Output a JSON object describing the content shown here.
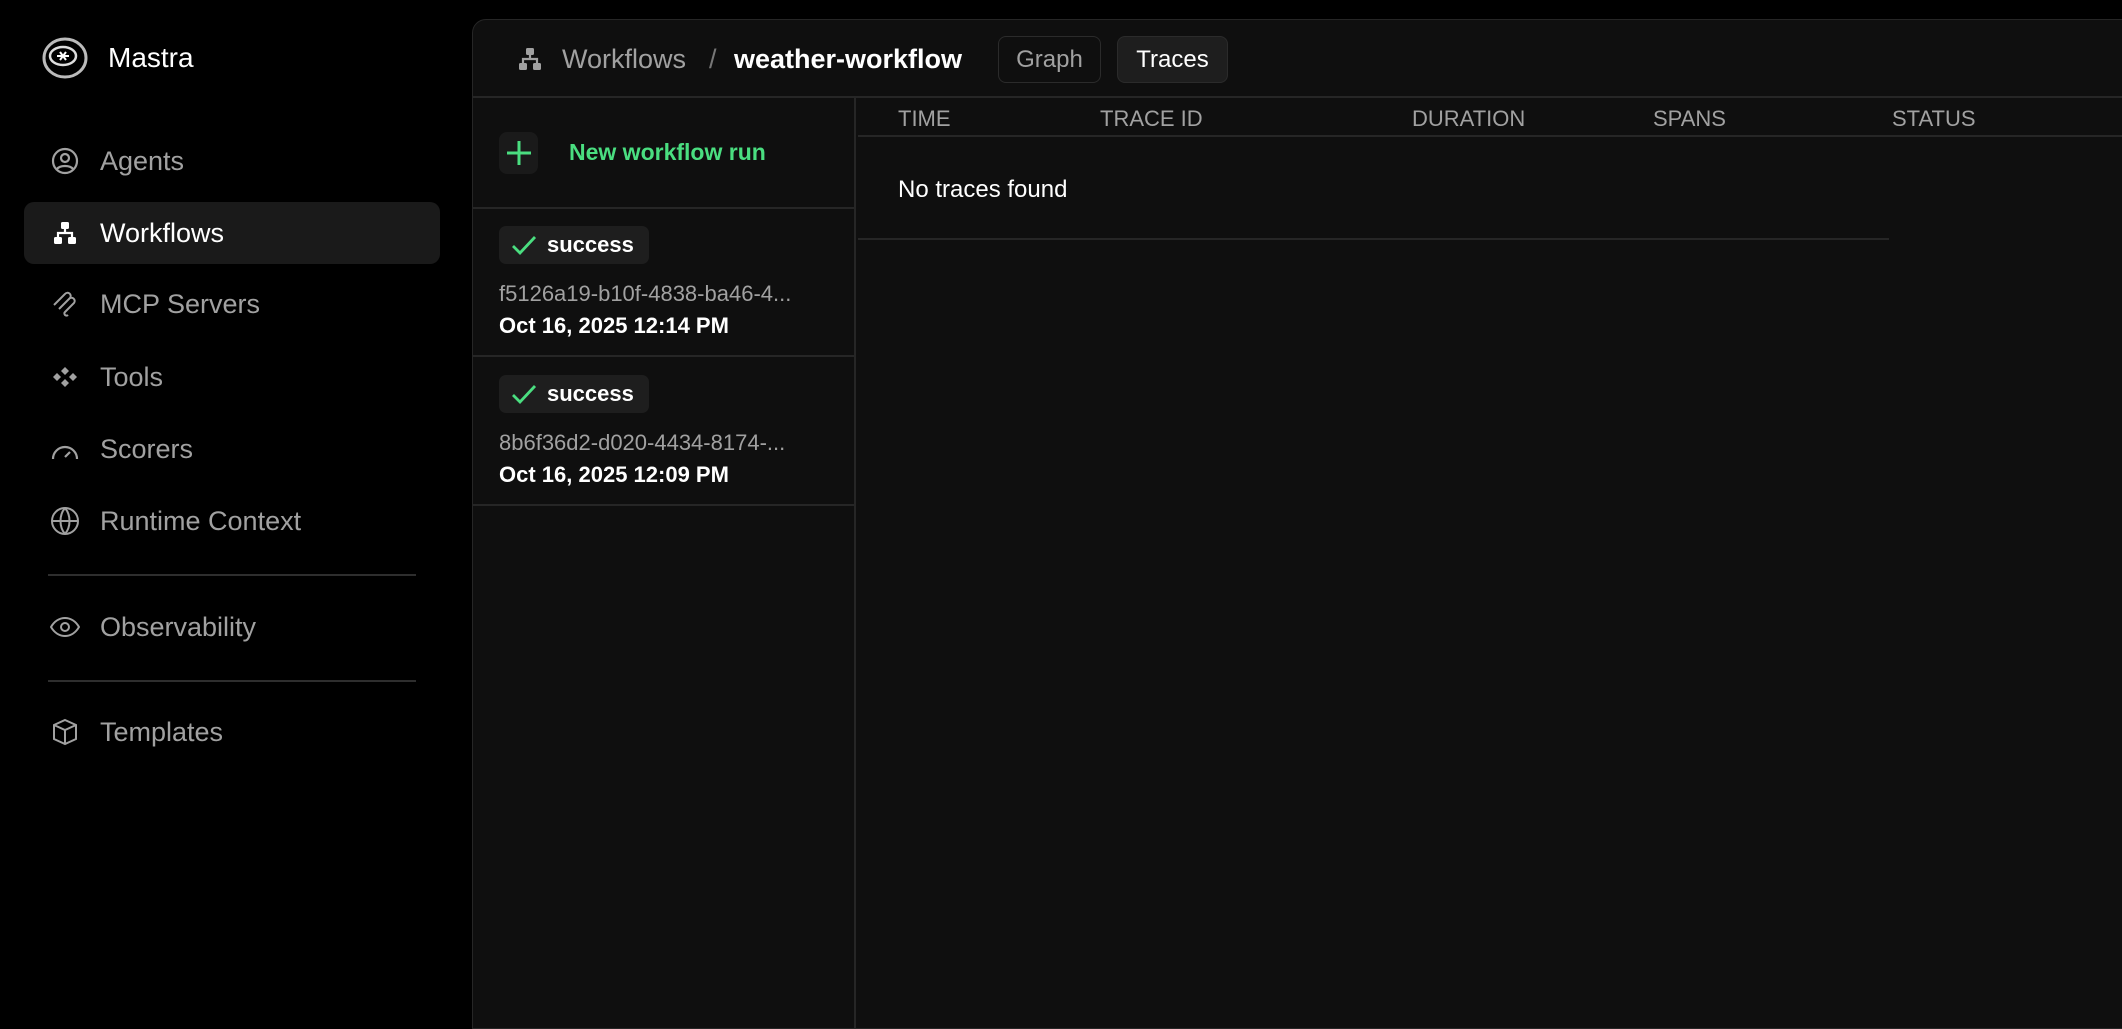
{
  "app": {
    "brand": "Mastra"
  },
  "sidebar": {
    "items": [
      {
        "label": "Agents",
        "icon": "user-circle-icon"
      },
      {
        "label": "Workflows",
        "icon": "workflow-icon",
        "active": true
      },
      {
        "label": "MCP Servers",
        "icon": "mcp-icon"
      },
      {
        "label": "Tools",
        "icon": "tools-icon"
      },
      {
        "label": "Scorers",
        "icon": "gauge-icon"
      },
      {
        "label": "Runtime Context",
        "icon": "globe-icon"
      },
      {
        "label": "Observability",
        "icon": "eye-icon"
      },
      {
        "label": "Templates",
        "icon": "box-icon"
      }
    ]
  },
  "header": {
    "crumb_parent": "Workflows",
    "separator": "/",
    "crumb_current": "weather-workflow",
    "tabs": [
      {
        "label": "Graph"
      },
      {
        "label": "Traces",
        "active": true
      }
    ]
  },
  "runs": {
    "new_label": "New workflow run",
    "items": [
      {
        "status": "success",
        "id": "f5126a19-b10f-4838-ba46-4...",
        "date": "Oct 16, 2025 12:14 PM"
      },
      {
        "status": "success",
        "id": "8b6f36d2-d020-4434-8174-...",
        "date": "Oct 16, 2025 12:09 PM"
      }
    ]
  },
  "traces": {
    "columns": [
      "TIME",
      "TRACE ID",
      "DURATION",
      "SPANS",
      "STATUS"
    ],
    "empty": "No traces found"
  },
  "colors": {
    "accent": "#4ade80",
    "bg": "#0f0f0f"
  }
}
